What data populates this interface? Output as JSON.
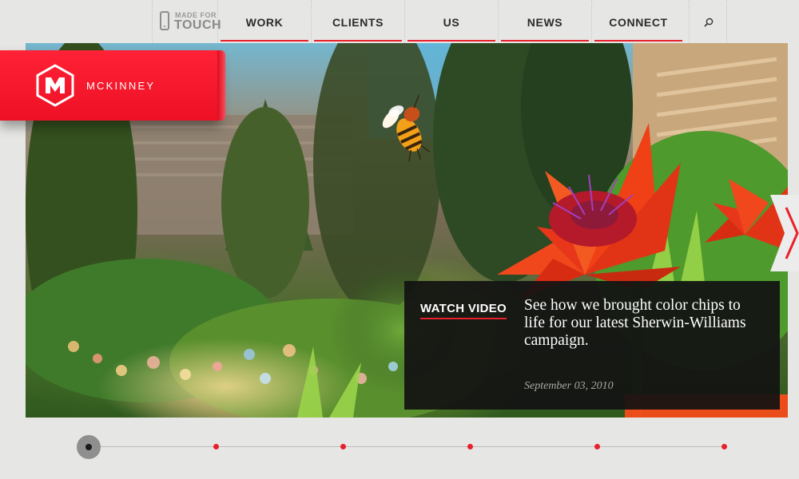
{
  "badge": {
    "line1": "MADE FOR",
    "line2": "TOUCH"
  },
  "nav": {
    "items": [
      {
        "label": "WORK"
      },
      {
        "label": "CLIENTS"
      },
      {
        "label": "US"
      },
      {
        "label": "NEWS"
      },
      {
        "label": "CONNECT"
      }
    ],
    "search_icon": "search-icon"
  },
  "brand": {
    "name": "MCKINNEY",
    "logo_icon": "mckinney-hexagon-m-logo",
    "color": "#ee1024"
  },
  "slide": {
    "cta": "WATCH VIDEO",
    "description": "See how we brought color chips to life for our latest Sherwin-Williams campaign.",
    "date": "September 03, 2010",
    "next_icon": "chevron-right-icon"
  },
  "timeline": {
    "active_index": 0,
    "dot_count": 5,
    "accent": "#e8202a"
  },
  "colors": {
    "accent": "#e8202a",
    "caption_bg": "#121212",
    "page_bg": "#e6e6e4"
  }
}
